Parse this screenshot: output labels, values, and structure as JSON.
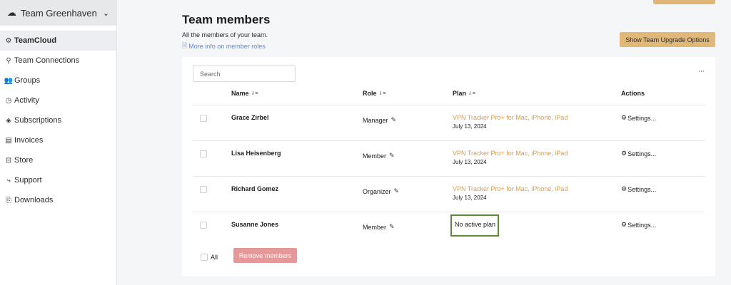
{
  "sidebar": {
    "team_name": "Team Greenhaven",
    "team_icon": "cloud-icon",
    "items": [
      {
        "label": "TeamCloud",
        "icon": "gear-icon",
        "active": true
      },
      {
        "label": "Team Connections",
        "icon": "connections-icon"
      },
      {
        "label": "Groups",
        "icon": "groups-icon"
      },
      {
        "label": "Activity",
        "icon": "clock-icon"
      },
      {
        "label": "Subscriptions",
        "icon": "layers-icon"
      },
      {
        "label": "Invoices",
        "icon": "invoice-icon"
      },
      {
        "label": "Store",
        "icon": "cart-icon"
      },
      {
        "label": "Support",
        "icon": "support-icon"
      },
      {
        "label": "Downloads",
        "icon": "download-icon"
      }
    ]
  },
  "header": {
    "title": "Team members",
    "subtitle": "All the members of your team.",
    "more_info": "More info on member roles",
    "upgrade_button": "Show Team Upgrade Options"
  },
  "table": {
    "search_placeholder": "Search",
    "columns": {
      "name": "Name",
      "role": "Role",
      "plan": "Plan",
      "actions": "Actions"
    },
    "rows": [
      {
        "name": "Grace Zirbel",
        "role": "Manager",
        "plan": "VPN Tracker Pro+ for Mac, iPhone, iPad",
        "date": "July 13, 2024",
        "action": "Settings..."
      },
      {
        "name": "Lisa Heisenberg",
        "role": "Member",
        "plan": "VPN Tracker Pro+ for Mac, iPhone, iPad",
        "date": "July 13, 2024",
        "action": "Settings..."
      },
      {
        "name": "Richard Gomez",
        "role": "Organizer",
        "plan": "VPN Tracker Pro+ for Mac, iPhone, iPad",
        "date": "July 13, 2024",
        "action": "Settings..."
      },
      {
        "name": "Susanne Jones",
        "role": "Member",
        "plan": "No active plan",
        "date": "",
        "action": "Settings..."
      }
    ],
    "select_all": "All",
    "remove_button": "Remove members"
  },
  "colors": {
    "accent": "#e2b878",
    "plan_link": "#e09a47",
    "remove_button": "#e49898",
    "highlight_border": "#5d8a3a",
    "link": "#5b8bd9"
  }
}
